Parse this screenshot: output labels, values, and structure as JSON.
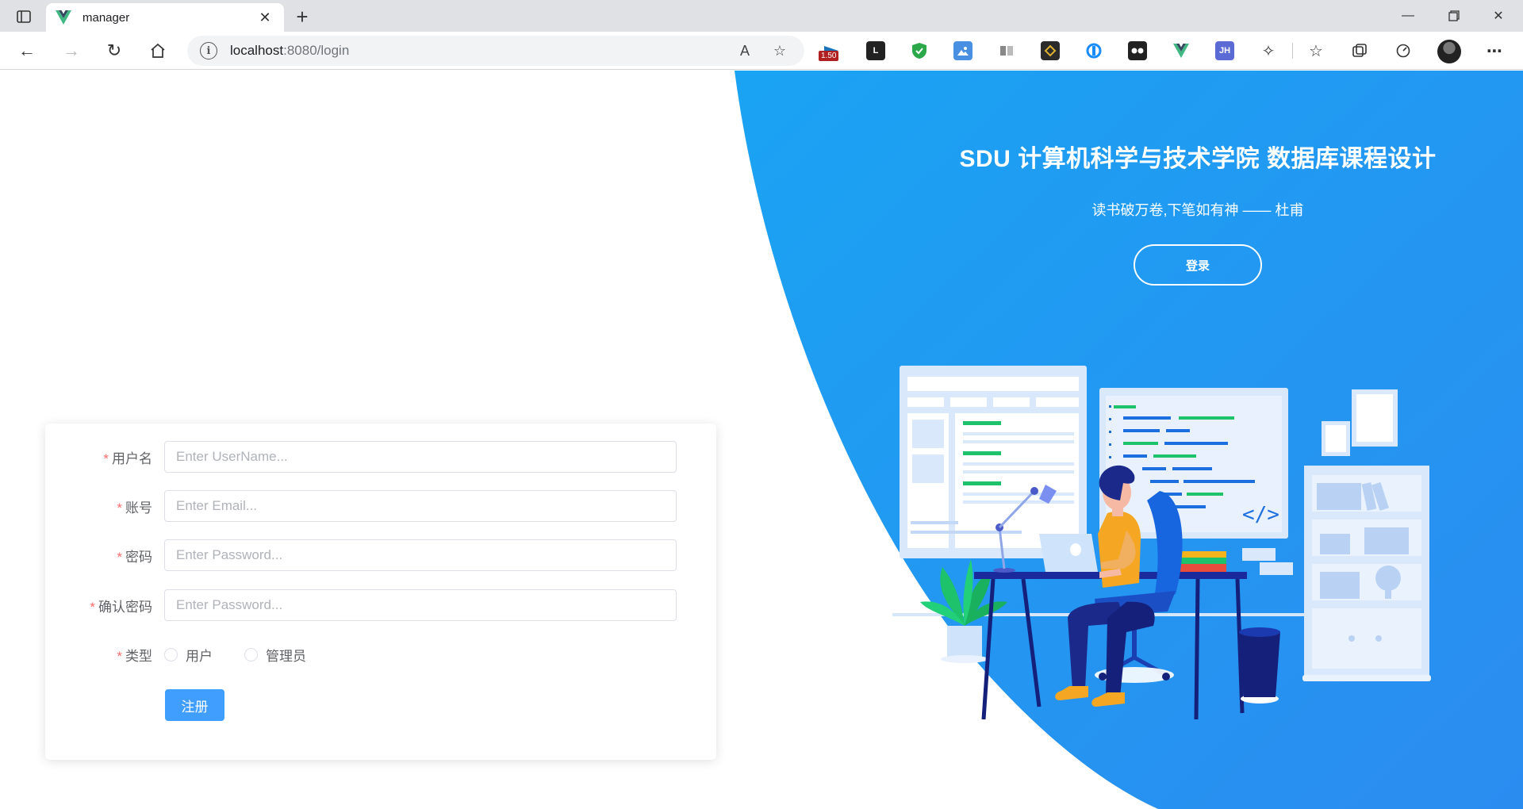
{
  "browser": {
    "tab_title": "manager",
    "url_host": "localhost",
    "url_rest": ":8080/login",
    "extension_badge": "1.50",
    "ext_jh_label": "JH"
  },
  "hero": {
    "title": "SDU 计算机科学与技术学院 数据库课程设计",
    "subtitle": "读书破万卷,下笔如有神 —— 杜甫",
    "login_button": "登录"
  },
  "form": {
    "username": {
      "label": "用户名",
      "placeholder": "Enter UserName..."
    },
    "account": {
      "label": "账号",
      "placeholder": "Enter Email..."
    },
    "password": {
      "label": "密码",
      "placeholder": "Enter Password..."
    },
    "confirm_password": {
      "label": "确认密码",
      "placeholder": "Enter Password..."
    },
    "type": {
      "label": "类型",
      "options": [
        "用户",
        "管理员"
      ]
    },
    "required_mark": "*",
    "submit_label": "注册"
  },
  "illustration": {
    "code_symbol": "</>"
  },
  "colors": {
    "primary": "#409eff",
    "hero_blue": "#1d9bf0",
    "required": "#f56c6c"
  }
}
